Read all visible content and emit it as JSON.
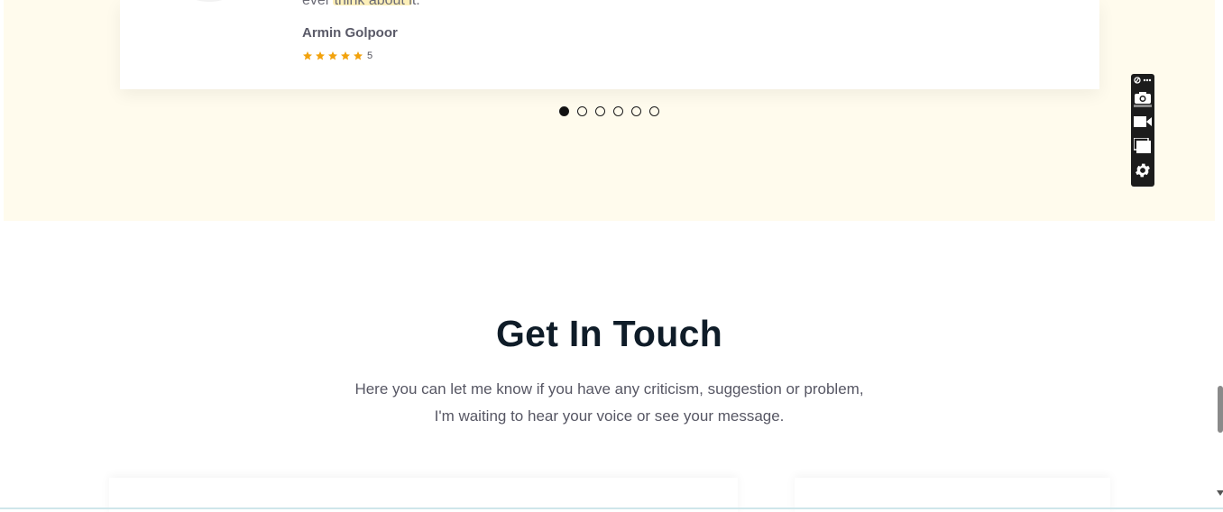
{
  "testimonial": {
    "quote_tail": "ever think about it.",
    "reviewer_name": "Armin Golpoor",
    "rating_value": "5",
    "stars": 5
  },
  "carousel": {
    "slides": 6,
    "active_index": 0
  },
  "contact": {
    "title": "Get In Touch",
    "subtitle_line1": "Here you can let me know if you have any criticism, suggestion or problem,",
    "subtitle_line2": "I'm waiting to hear your voice or see your message."
  },
  "toolbar": {
    "items": [
      "pin-more-icon",
      "camera-icon",
      "video-icon",
      "window-icon",
      "gear-icon"
    ]
  },
  "colors": {
    "section_bg": "#fffbed",
    "star": "#f2a20c",
    "title": "#0f1c28",
    "text": "#575764"
  }
}
